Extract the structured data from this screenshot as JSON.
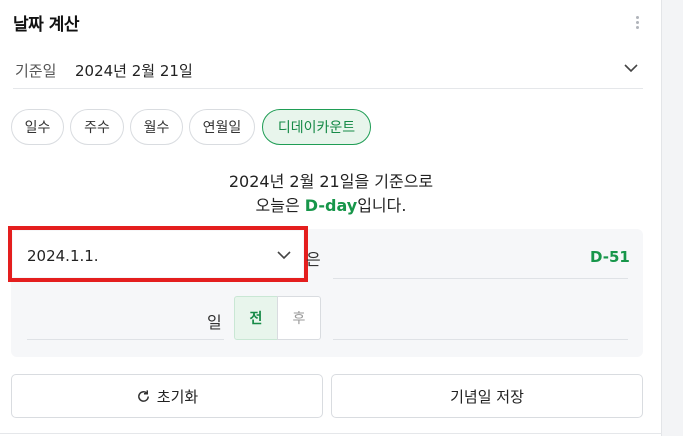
{
  "header": {
    "title": "날짜 계산",
    "more_icon": "kebab-vertical-icon"
  },
  "base_date": {
    "label": "기준일",
    "value": "2024년 2월 21일"
  },
  "tabs": [
    {
      "label": "일수",
      "active": false
    },
    {
      "label": "주수",
      "active": false
    },
    {
      "label": "월수",
      "active": false
    },
    {
      "label": "연월일",
      "active": false
    },
    {
      "label": "디데이카운트",
      "active": true
    }
  ],
  "message": {
    "line1": "2024년 2월 21일을 기준으로",
    "line2_prefix": "오늘은 ",
    "line2_highlight": "D-day",
    "line2_suffix": "입니다."
  },
  "calc": {
    "target_date": "2024.1.1.",
    "particle": "은",
    "result": "D-51",
    "day_label": "일",
    "before_label": "전",
    "after_label": "후"
  },
  "actions": {
    "reset_label": "초기화",
    "save_label": "기념일 저장"
  },
  "colors": {
    "accent": "#17964a",
    "accent_bg": "#e8f5ec",
    "highlight_border": "#e41e1e"
  }
}
